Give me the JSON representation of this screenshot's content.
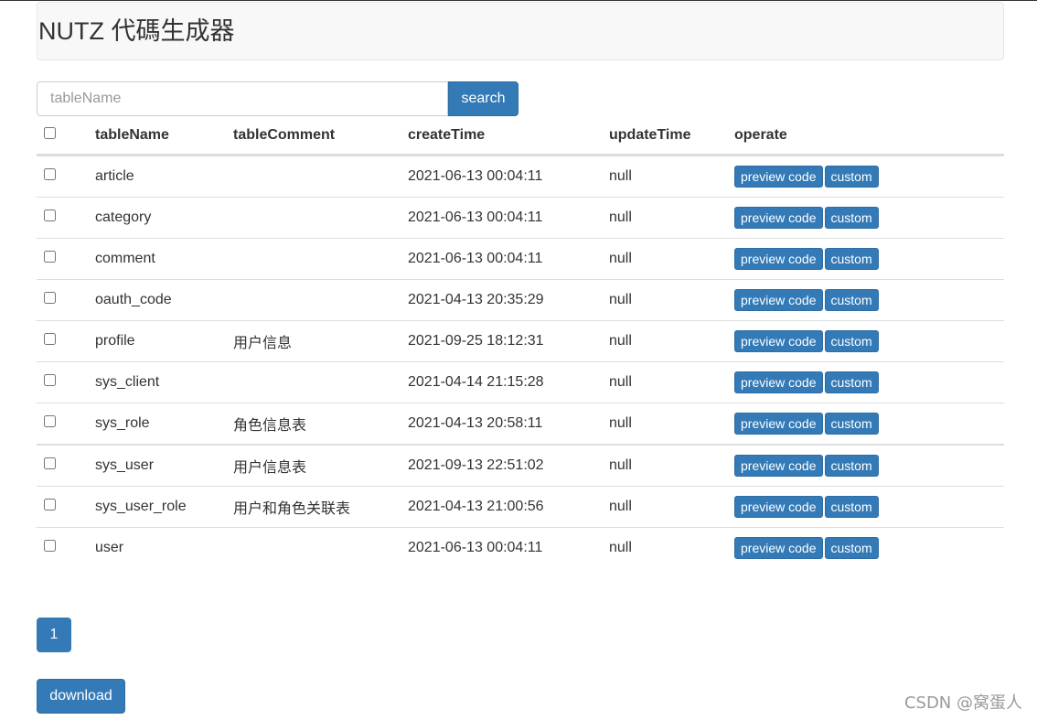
{
  "header": {
    "title": "NUTZ 代碼生成器"
  },
  "search": {
    "placeholder": "tableName",
    "value": "",
    "button_label": "search"
  },
  "table": {
    "columns": [
      "tableName",
      "tableComment",
      "createTime",
      "updateTime",
      "operate"
    ],
    "rows": [
      {
        "tableName": "article",
        "tableComment": "",
        "createTime": "2021-06-13 00:04:11",
        "updateTime": "null"
      },
      {
        "tableName": "category",
        "tableComment": "",
        "createTime": "2021-06-13 00:04:11",
        "updateTime": "null"
      },
      {
        "tableName": "comment",
        "tableComment": "",
        "createTime": "2021-06-13 00:04:11",
        "updateTime": "null"
      },
      {
        "tableName": "oauth_code",
        "tableComment": "",
        "createTime": "2021-04-13 20:35:29",
        "updateTime": "null"
      },
      {
        "tableName": "profile",
        "tableComment": "用户信息",
        "createTime": "2021-09-25 18:12:31",
        "updateTime": "null"
      },
      {
        "tableName": "sys_client",
        "tableComment": "",
        "createTime": "2021-04-14 21:15:28",
        "updateTime": "null"
      },
      {
        "tableName": "sys_role",
        "tableComment": "角色信息表",
        "createTime": "2021-04-13 20:58:11",
        "updateTime": "null"
      },
      {
        "tableName": "sys_user",
        "tableComment": "用户信息表",
        "createTime": "2021-09-13 22:51:02",
        "updateTime": "null"
      },
      {
        "tableName": "sys_user_role",
        "tableComment": "用户和角色关联表",
        "createTime": "2021-04-13 21:00:56",
        "updateTime": "null"
      },
      {
        "tableName": "user",
        "tableComment": "",
        "createTime": "2021-06-13 00:04:11",
        "updateTime": "null"
      }
    ],
    "actions": {
      "preview_label": "preview code",
      "custom_label": "custom"
    }
  },
  "pagination": {
    "current_page": "1"
  },
  "download": {
    "label": "download"
  },
  "watermark": {
    "text": "CSDN @窝蛋人"
  },
  "colors": {
    "primary": "#337ab7",
    "primary_border": "#2e6da4",
    "jumbotron_bg": "#f8f8f8",
    "border": "#dddddd"
  }
}
